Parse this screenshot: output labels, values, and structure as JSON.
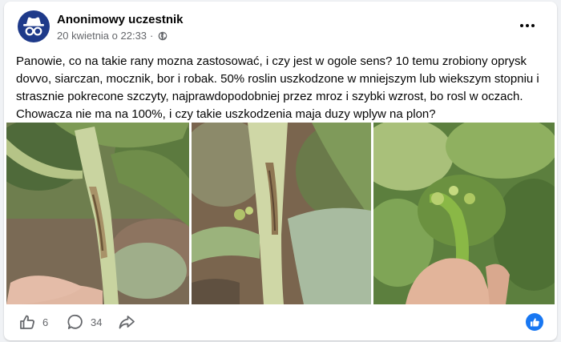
{
  "post": {
    "author": "Anonimowy uczestnik",
    "date": "20 kwietnia o 22:33",
    "separator": "·",
    "text": "Panowie, co na takie rany mozna zastosować, i czy jest w ogole sens? 10 temu zrobiony oprysk dovvo, siarczan, mocznik, bor i robak. 50% roslin uszkodzone w mniejszym lub wiekszym stopniu i strasznie pokrecone szczyty, najprawdopodobniej przez mroz i szybki wzrost, bo rosl w oczach. Chowacza nie ma na 100%, i czy takie uszkodzenia maja duzy wplyw na plon?",
    "privacy_icon": "globe-icon",
    "menu_icon": "more-options-icon"
  },
  "actions": {
    "likes": "6",
    "comments": "34",
    "like_icon": "thumbs-up-icon",
    "comment_icon": "comment-icon",
    "share_icon": "share-icon",
    "reaction_icon": "like-reaction-icon"
  },
  "colors": {
    "avatar_bg": "#1e3a8a",
    "brand_blue": "#1877f2",
    "secondary_text": "#65676b"
  }
}
